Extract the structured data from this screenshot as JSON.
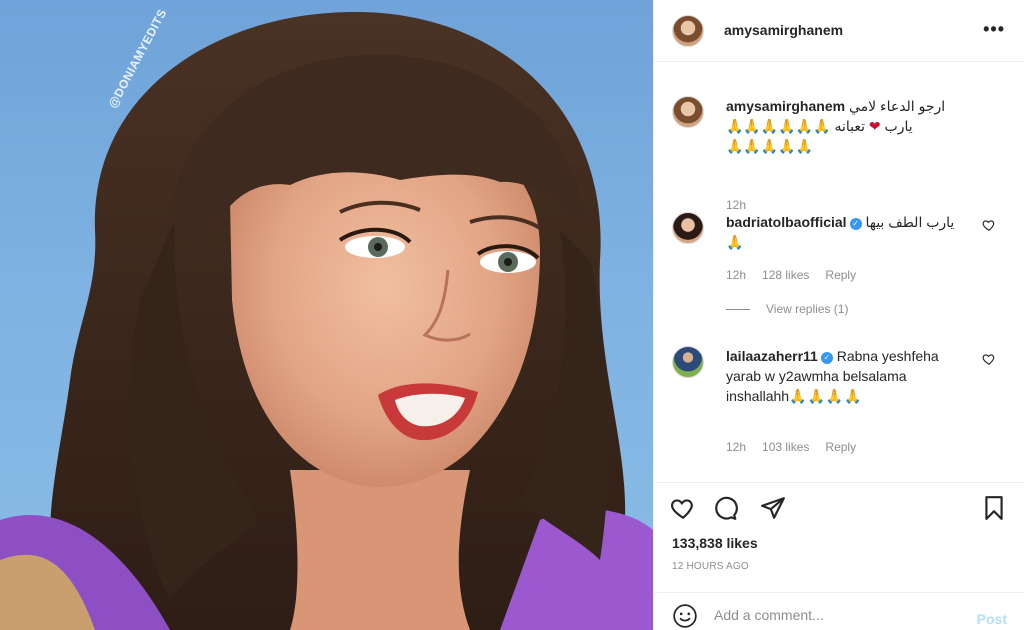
{
  "photo": {
    "watermark": "@DONIAMYEDITS",
    "description_icon": "portrait-photo"
  },
  "header": {
    "username": "amysamirghanem",
    "more_icon": "more-options-icon"
  },
  "caption": {
    "username": "amysamirghanem",
    "text_ar": "ارجو الدعاء لامي",
    "text_ar2": "تعبانه",
    "text_ar3": "يارب",
    "hands_line1": "🙏🙏🙏🙏🙏🙏",
    "hands_line2": "🙏🙏🙏🙏🙏",
    "time": "12h"
  },
  "comments": [
    {
      "username": "badriatolbaofficial",
      "verified": true,
      "text": "يارب الطف بيها",
      "emoji": "🙏",
      "time": "12h",
      "likes": "128 likes",
      "reply": "Reply"
    },
    {
      "username": "lailaazaherr11",
      "verified": true,
      "text": "Rabna yeshfeha yarab w y2awmha belsalama inshallahh",
      "emoji": "🙏🙏🙏🙏",
      "time": "12h",
      "likes": "103 likes",
      "reply": "Reply"
    }
  ],
  "view_replies": "View replies (1)",
  "actions": {
    "likes": "133,838 likes",
    "age": "12 HOURS AGO"
  },
  "add_comment": {
    "placeholder": "Add a comment...",
    "post_label": "Post"
  },
  "colors": {
    "accent_blue": "#3897f0",
    "post_disabled": "#b2dffc",
    "muted_text": "#8e8e8e"
  }
}
